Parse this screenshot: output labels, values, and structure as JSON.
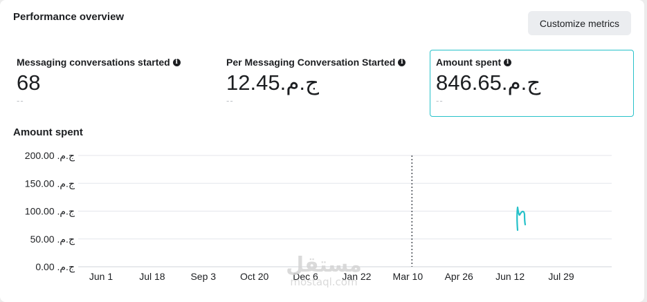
{
  "header": {
    "title": "Performance overview",
    "customize_label": "Customize metrics"
  },
  "metrics": [
    {
      "label": "Messaging conversations started",
      "value": "68",
      "compare": "--"
    },
    {
      "label": "Per Messaging Conversation Started",
      "value": "ج.م.12.45",
      "compare": "--"
    },
    {
      "label": "Amount spent",
      "value": "ج.م.846.65",
      "compare": "--",
      "selected": true
    }
  ],
  "info_icon_glyph": "i",
  "chart_data": {
    "type": "line",
    "title": "Amount spent",
    "xlabel": "",
    "ylabel": "",
    "ylim": [
      0,
      200
    ],
    "y_ticks": [
      {
        "value": 200,
        "label": "200.00 .ج.م"
      },
      {
        "value": 150,
        "label": "150.00 .ج.م"
      },
      {
        "value": 100,
        "label": "100.00 .ج.م"
      },
      {
        "value": 50,
        "label": "50.00 .ج.م"
      },
      {
        "value": 0,
        "label": "0.00 .ج.م"
      }
    ],
    "x_ticks": [
      "Jun 1",
      "Jul 18",
      "Sep 3",
      "Oct 20",
      "Dec 6",
      "Jan 22",
      "Mar 10",
      "Apr 26",
      "Jun 12",
      "Jul 29"
    ],
    "marker_index": 6,
    "grid": true,
    "accent_color": "#26c1c9"
  },
  "watermark": {
    "arabic": "مستقل",
    "latin": "mostaql.com"
  }
}
